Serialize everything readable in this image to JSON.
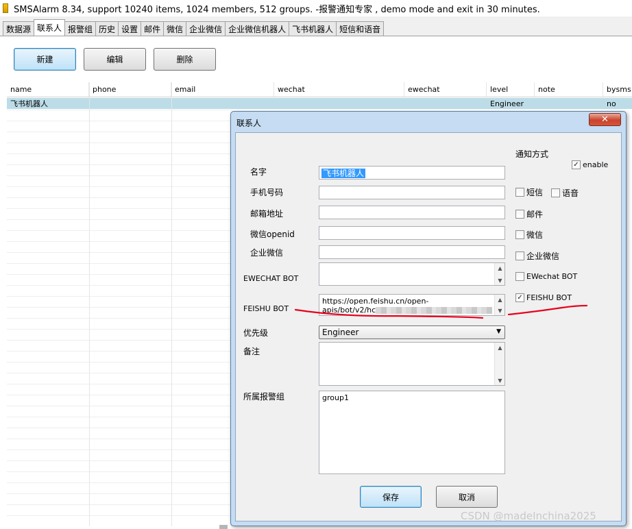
{
  "window": {
    "title": "SMSAlarm 8.34, support 10240 items, 1024 members, 512 groups. -报警通知专家 , demo mode and exit in 30 minutes."
  },
  "tabs": [
    "数据源",
    "联系人",
    "报警组",
    "历史",
    "设置",
    "邮件",
    "微信",
    "企业微信",
    "企业微信机器人",
    "飞书机器人",
    "短信和语音"
  ],
  "active_tab": "联系人",
  "toolbar": {
    "new_label": "新建",
    "edit_label": "编辑",
    "delete_label": "删除"
  },
  "grid": {
    "columns": [
      "name",
      "phone",
      "email",
      "wechat",
      "ewechat",
      "level",
      "note",
      "bysms"
    ],
    "rows": [
      {
        "name": "飞书机器人",
        "phone": "",
        "email": "",
        "wechat": "",
        "ewechat": "",
        "level": "Engineer",
        "note": "",
        "bysms": "no"
      }
    ]
  },
  "dialog": {
    "title": "联系人",
    "close_label": "✕",
    "labels": {
      "name": "名字",
      "phone": "手机号码",
      "email": "邮箱地址",
      "wechat": "微信openid",
      "ewechat": "企业微信",
      "ewechat_bot": "EWECHAT BOT",
      "feishu_bot": "FEISHU BOT",
      "priority": "优先级",
      "note": "备注",
      "groups": "所属报警组"
    },
    "values": {
      "name": "飞书机器人",
      "phone": "",
      "email": "",
      "wechat": "",
      "ewechat": "",
      "ewechat_bot": "",
      "feishu_bot_line1": "https://open.feishu.cn/open-",
      "feishu_bot_line2": "apis/bot/v2/hc",
      "priority": "Engineer",
      "note": "",
      "groups": "group1"
    },
    "notify": {
      "heading": "通知方式",
      "enable": {
        "label": "enable",
        "checked": true
      },
      "sms": {
        "label": "短信",
        "checked": false
      },
      "voice": {
        "label": "语音",
        "checked": false
      },
      "mail": {
        "label": "邮件",
        "checked": false
      },
      "wechat": {
        "label": "微信",
        "checked": false
      },
      "ewechat": {
        "label": "企业微信",
        "checked": false
      },
      "ewechat_bot": {
        "label": "EWechat BOT",
        "checked": false
      },
      "feishu_bot": {
        "label": "FEISHU BOT",
        "checked": true
      }
    },
    "save_label": "保存",
    "cancel_label": "取消"
  },
  "watermark": "CSDN @madeInchina2025",
  "colors": {
    "selection_row": "#bcdce8",
    "dialog_frame": "#c5dcf2",
    "close_button": "#c8442c",
    "annotation": "#e8001c"
  }
}
